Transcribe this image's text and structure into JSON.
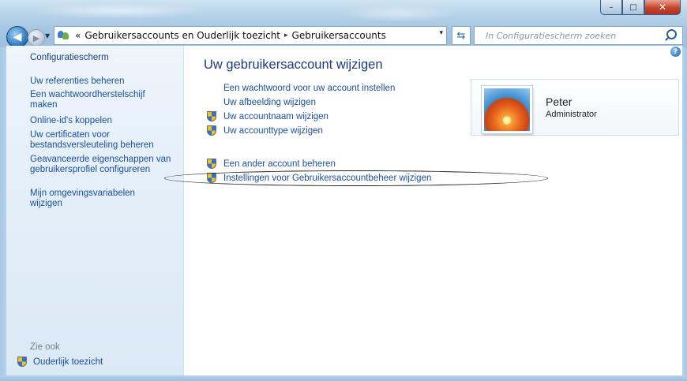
{
  "window": {
    "buttons": {
      "minimize": "–",
      "maximize": "□",
      "close": "✕"
    }
  },
  "address": {
    "breadcrumb_prefix": "«",
    "crumbs": [
      "Gebruikersaccounts en Ouderlijk toezicht",
      "Gebruikersaccounts"
    ],
    "separator": "▸",
    "dropdown": "▾"
  },
  "search": {
    "placeholder": "In Configuratiescherm zoeken"
  },
  "sidebar": {
    "home": "Configuratiescherm",
    "items": [
      {
        "label": "Uw referenties beheren"
      },
      {
        "label": "Een wachtwoordherstelschijf maken"
      },
      {
        "label": "Online-id's koppelen"
      },
      {
        "label": "Uw certificaten voor bestandsversleuteling beheren"
      },
      {
        "label": "Geavanceerde eigenschappen van gebruikersprofiel configureren"
      },
      {
        "label": "Mijn omgevingsvariabelen wijzigen"
      }
    ],
    "see_also": "Zie ook",
    "see_also_items": [
      {
        "label": "Ouderlijk toezicht"
      }
    ]
  },
  "main": {
    "title": "Uw gebruikersaccount wijzigen",
    "tasks": [
      {
        "label": "Een wachtwoord voor uw account instellen",
        "shield": false
      },
      {
        "label": "Uw afbeelding wijzigen",
        "shield": false
      },
      {
        "label": "Uw accountnaam wijzigen",
        "shield": true
      },
      {
        "label": "Uw accounttype wijzigen",
        "shield": true
      }
    ],
    "other_tasks": [
      {
        "label": "Een ander account beheren",
        "shield": true
      },
      {
        "label": "Instellingen voor Gebruikersaccountbeheer wijzigen",
        "shield": true
      }
    ]
  },
  "user": {
    "name": "Peter",
    "role": "Administrator"
  },
  "help": "?"
}
